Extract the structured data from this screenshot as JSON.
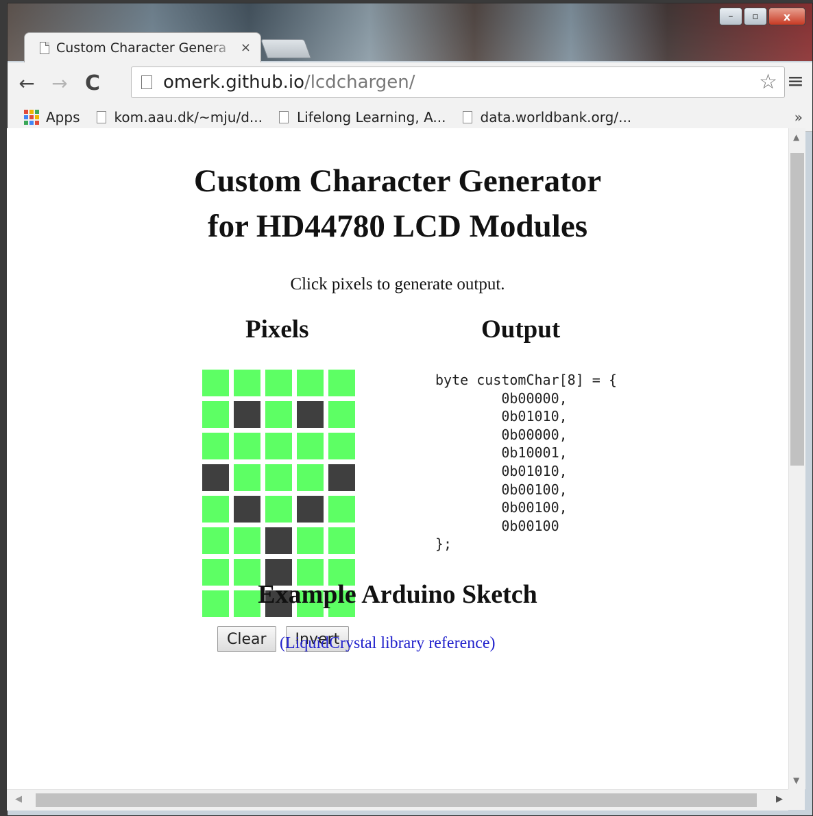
{
  "browser": {
    "tab_title": "Custom Character Genera",
    "tab_close": "×",
    "url_host": "omerk.github.io",
    "url_path": "/lcdchargen/",
    "back": "←",
    "forward": "→",
    "reload": "C",
    "star": "☆",
    "menu": "≡",
    "window_buttons": {
      "minimize": "–",
      "maximize": "▫",
      "close": "x"
    },
    "bookmarks": {
      "apps_label": "Apps",
      "items": [
        "kom.aau.dk/~mju/d...",
        "Lifelong Learning, A...",
        "data.worldbank.org/..."
      ],
      "more": "»"
    }
  },
  "page": {
    "title_line1": "Custom Character Generator",
    "title_line2": "for HD44780 LCD Modules",
    "intro": "Click pixels to generate output.",
    "pixels_heading": "Pixels",
    "output_heading": "Output",
    "pixel_rows": [
      [
        0,
        0,
        0,
        0,
        0
      ],
      [
        0,
        1,
        0,
        1,
        0
      ],
      [
        0,
        0,
        0,
        0,
        0
      ],
      [
        1,
        0,
        0,
        0,
        1
      ],
      [
        0,
        1,
        0,
        1,
        0
      ],
      [
        0,
        0,
        1,
        0,
        0
      ],
      [
        0,
        0,
        1,
        0,
        0
      ],
      [
        0,
        0,
        1,
        0,
        0
      ]
    ],
    "pixel_on_color": "#3f3f3f",
    "pixel_off_color": "#5dff64",
    "clear_label": "Clear",
    "invert_label": "Invert",
    "output_code": "byte customChar[8] = {\n\t0b00000,\n\t0b01010,\n\t0b00000,\n\t0b10001,\n\t0b01010,\n\t0b00100,\n\t0b00100,\n\t0b00100\n};",
    "sketch_heading": "Example Arduino Sketch",
    "sketch_link": "(LiquidCrystal library reference)"
  },
  "scrollbars": {
    "up": "▲",
    "down": "▼",
    "left": "◀",
    "right": "▶"
  }
}
